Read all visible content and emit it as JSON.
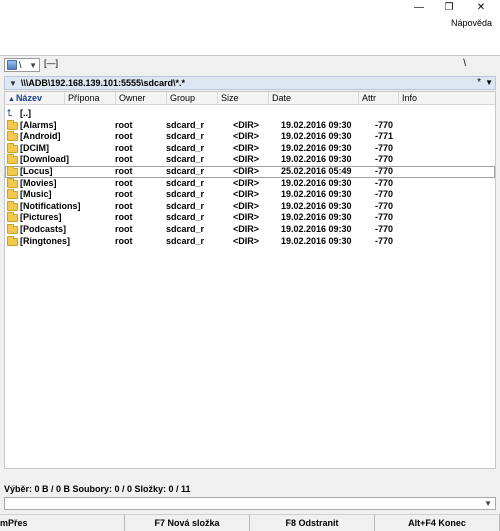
{
  "window": {
    "minimize_glyph": "—",
    "restore_glyph": "❐",
    "close_glyph": "✕"
  },
  "menu": {
    "help": "Nápověda"
  },
  "drivebar": {
    "drive_separator": "\\",
    "drive_info": "[—]",
    "root_glyph": "\\",
    "history_glyph": "*"
  },
  "path": {
    "text": "\\\\\\ADB\\192.168.139.101:5555\\sdcard\\*.*"
  },
  "columns": [
    {
      "label": "Název",
      "sorted": true
    },
    {
      "label": "Přípona"
    },
    {
      "label": "Owner"
    },
    {
      "label": "Group"
    },
    {
      "label": "Size"
    },
    {
      "label": "Date"
    },
    {
      "label": "Attr"
    },
    {
      "label": "Info"
    }
  ],
  "parent_row": {
    "name": "[..]"
  },
  "files": [
    {
      "name": "[Alarms]",
      "owner": "root",
      "group": "sdcard_r",
      "size": "<DIR>",
      "date": "19.02.2016 09:30",
      "attr": "-770"
    },
    {
      "name": "[Android]",
      "owner": "root",
      "group": "sdcard_r",
      "size": "<DIR>",
      "date": "19.02.2016 09:30",
      "attr": "-771"
    },
    {
      "name": "[DCIM]",
      "owner": "root",
      "group": "sdcard_r",
      "size": "<DIR>",
      "date": "19.02.2016 09:30",
      "attr": "-770"
    },
    {
      "name": "[Download]",
      "owner": "root",
      "group": "sdcard_r",
      "size": "<DIR>",
      "date": "19.02.2016 09:30",
      "attr": "-770"
    },
    {
      "name": "[Locus]",
      "owner": "root",
      "group": "sdcard_r",
      "size": "<DIR>",
      "date": "25.02.2016 05:49",
      "attr": "-770",
      "focused": true
    },
    {
      "name": "[Movies]",
      "owner": "root",
      "group": "sdcard_r",
      "size": "<DIR>",
      "date": "19.02.2016 09:30",
      "attr": "-770"
    },
    {
      "name": "[Music]",
      "owner": "root",
      "group": "sdcard_r",
      "size": "<DIR>",
      "date": "19.02.2016 09:30",
      "attr": "-770"
    },
    {
      "name": "[Notifications]",
      "owner": "root",
      "group": "sdcard_r",
      "size": "<DIR>",
      "date": "19.02.2016 09:30",
      "attr": "-770"
    },
    {
      "name": "[Pictures]",
      "owner": "root",
      "group": "sdcard_r",
      "size": "<DIR>",
      "date": "19.02.2016 09:30",
      "attr": "-770"
    },
    {
      "name": "[Podcasts]",
      "owner": "root",
      "group": "sdcard_r",
      "size": "<DIR>",
      "date": "19.02.2016 09:30",
      "attr": "-770"
    },
    {
      "name": "[Ringtones]",
      "owner": "root",
      "group": "sdcard_r",
      "size": "<DIR>",
      "date": "19.02.2016 09:30",
      "attr": "-770"
    }
  ],
  "status": {
    "text": "Výběr: 0 B / 0 B  Soubory: 0 / 0  Složky: 0 / 11"
  },
  "fkeys": [
    {
      "label": "mPřes"
    },
    {
      "label": "F7 Nová složka"
    },
    {
      "label": "F8 Odstranit"
    },
    {
      "label": "Alt+F4 Konec"
    }
  ],
  "icons": {
    "sort_up": "▲",
    "up_dir": "⮤",
    "dropdown": "▼",
    "path_chevron": "▼"
  }
}
